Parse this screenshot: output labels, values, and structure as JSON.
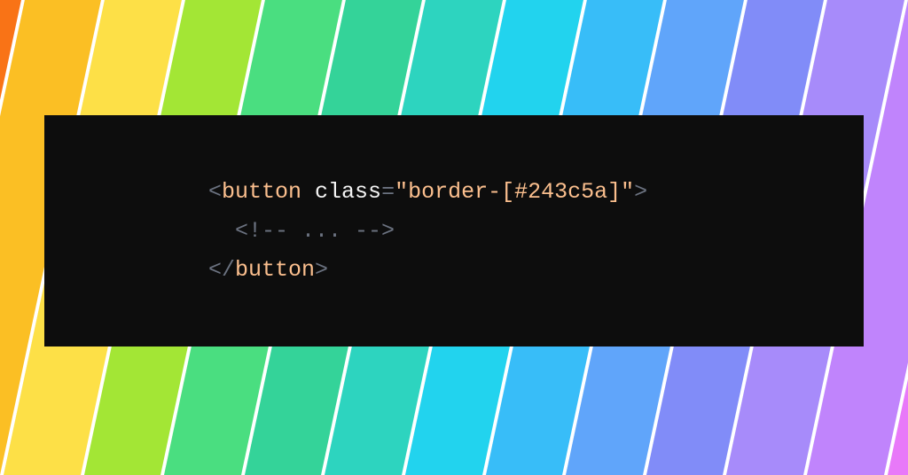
{
  "stripes": [
    "#f97316",
    "#fbbf24",
    "#fde047",
    "#a3e635",
    "#4ade80",
    "#34d399",
    "#2dd4bf",
    "#22d3ee",
    "#38bdf8",
    "#60a5fa",
    "#818cf8",
    "#a78bfa",
    "#c084fc",
    "#e879f9"
  ],
  "code": {
    "line1": {
      "open_angle": "<",
      "tag": "button",
      "space": " ",
      "attr": "class",
      "eq": "=",
      "quote_open": "\"",
      "value": "border-[#243c5a]",
      "quote_close": "\"",
      "close_angle": ">"
    },
    "line2": {
      "comment": "<!-- ... -->"
    },
    "line3": {
      "open": "</",
      "tag": "button",
      "close": ">"
    }
  }
}
